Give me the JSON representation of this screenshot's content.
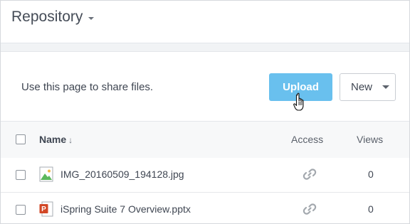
{
  "header": {
    "title": "Repository"
  },
  "toolbar": {
    "description": "Use this page to share files.",
    "upload_label": "Upload",
    "new_label": "New"
  },
  "table": {
    "columns": {
      "name": "Name",
      "name_sort_arrow": "↓",
      "access": "Access",
      "views": "Views"
    },
    "rows": [
      {
        "name": "IMG_20160509_194128.jpg",
        "icon": "image-file-icon",
        "access_icon": "link-icon",
        "views": "0"
      },
      {
        "name": "iSpring Suite 7 Overview.pptx",
        "icon": "powerpoint-file-icon",
        "access_icon": "link-icon",
        "views": "0"
      }
    ]
  },
  "colors": {
    "upload_button": "#69c0ee",
    "header_bg": "#f7f8f9",
    "text": "#3f4652"
  }
}
